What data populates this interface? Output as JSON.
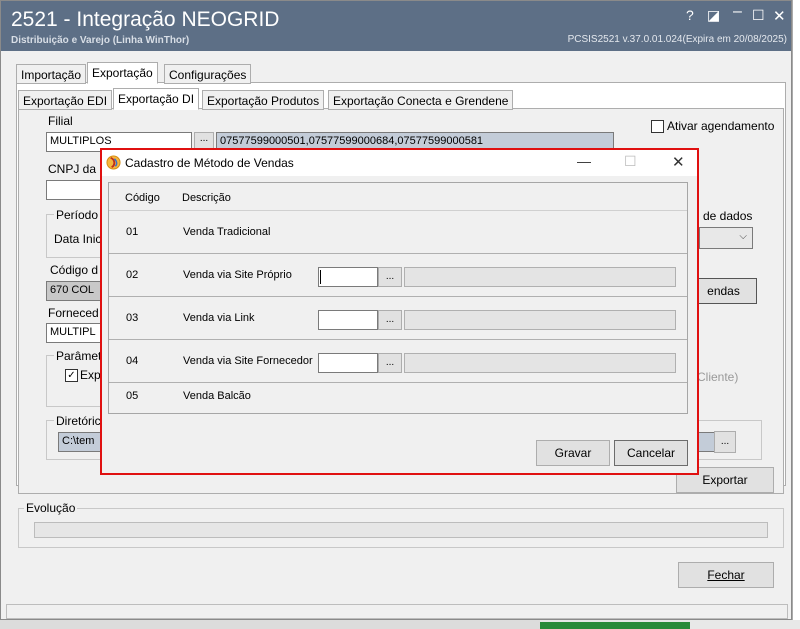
{
  "window": {
    "title": "2521 - Integração NEOGRID",
    "subtitle": "Distribuição e Varejo (Linha WinThor)",
    "version": "PCSIS2521  v.37.0.01.024(Expira em 20/08/2025)",
    "controls": {
      "help": "?",
      "edit": "◪",
      "minimize": "–",
      "maximize": "☐",
      "close": "✕"
    }
  },
  "top_tabs": [
    "Importação",
    "Exportação",
    "Configurações"
  ],
  "sub_tabs": [
    "Exportação EDI",
    "Exportação DI",
    "Exportação Produtos",
    "Exportação Conecta e Grendene"
  ],
  "form": {
    "filial_label": "Filial",
    "filial_value": "MULTIPLOS",
    "filial_button": "...",
    "filial_display": "07577599000501,07577599000684,07577599000581",
    "cnpj_label": "CNPJ da",
    "agendamento_label": "Ativar agendamento",
    "periodo_label": "Período",
    "data_inicio_label": "Data Inic",
    "base_dados_label": "de dados",
    "codigo_label": "Código d",
    "codigo_value": "670 COL",
    "vendas_button": "endas",
    "fornecedor_label": "Forneced",
    "fornecedor_value": "MULTIPL",
    "parametros_label": "Parâmet",
    "exp_check_label": "Exp",
    "cliente_text": "Cliente)",
    "diretorio_label": "Diretóric",
    "diretorio_value": "C:\\tem",
    "diretorio_button": "...",
    "exportar_button": "Exportar"
  },
  "evolucao": {
    "label": "Evolução",
    "progress": 0
  },
  "fechar_button": "Fechar",
  "dialog": {
    "title": "Cadastro de Método de Vendas",
    "controls": {
      "minimize": "—",
      "maximize": "☐",
      "close": "✕"
    },
    "columns": [
      "Código",
      "Descrição"
    ],
    "rows": [
      {
        "codigo": "01",
        "descricao": "Venda Tradicional"
      },
      {
        "codigo": "02",
        "descricao": "Venda via Site Próprio",
        "button": "..."
      },
      {
        "codigo": "03",
        "descricao": "Venda via Link",
        "button": "..."
      },
      {
        "codigo": "04",
        "descricao": "Venda via Site Fornecedor",
        "button": "..."
      },
      {
        "codigo": "05",
        "descricao": "Venda Balcão"
      }
    ],
    "gravar": "Gravar",
    "cancelar": "Cancelar"
  },
  "colors": {
    "titlebar": "#5d6f86",
    "dialog_border": "#e01010",
    "window_bg": "#f0f0f0"
  }
}
